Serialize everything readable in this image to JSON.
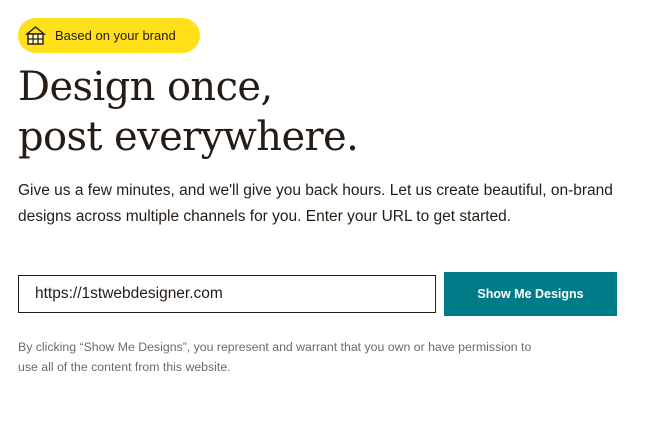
{
  "colors": {
    "badge_bg": "#ffe01b",
    "button_bg": "#007c89",
    "text": "#241c15",
    "muted_text": "#6e6a67"
  },
  "badge": {
    "icon": "brand-building-icon",
    "label": "Based on your brand"
  },
  "headline": {
    "line1": "Design once,",
    "line2": "post everywhere."
  },
  "description": "Give us a few minutes, and we'll give you back hours. Let us create beautiful, on-brand designs across multiple channels for you. Enter your URL to get started.",
  "url_input": {
    "value": "https://1stwebdesigner.com"
  },
  "submit_button": {
    "label": "Show Me Designs"
  },
  "disclaimer": "By clicking “Show Me Designs”, you represent and warrant that you own or have permission to use all of the content from this website."
}
